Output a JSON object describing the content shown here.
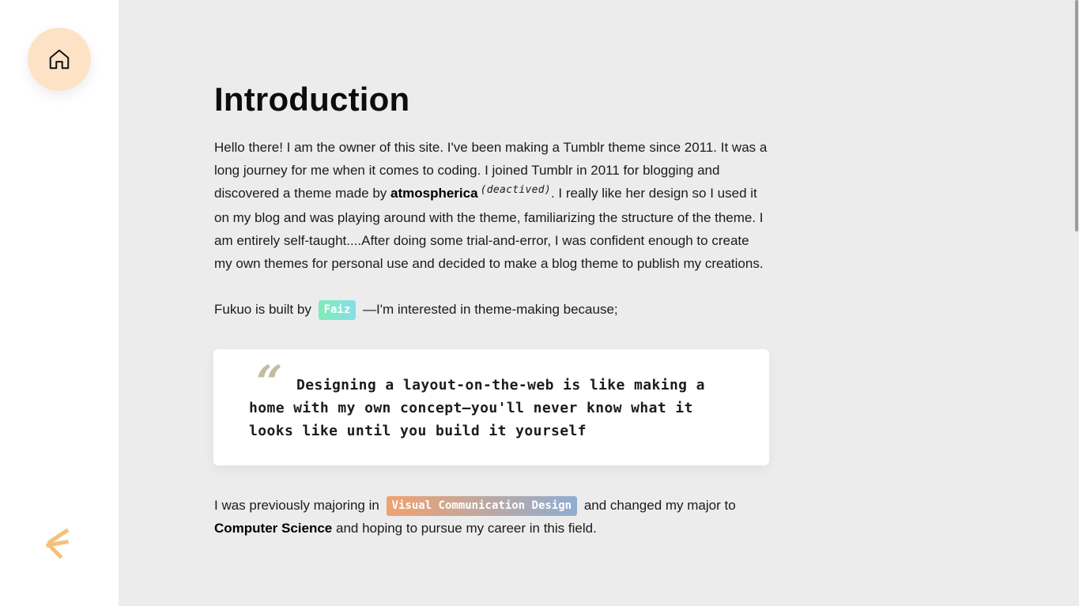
{
  "sidebar": {
    "home_icon": "home-icon",
    "logo_icon": "fukuo-logo-mark",
    "colors": {
      "home_bg": "#fde2c6",
      "logo": "#f5c07a"
    }
  },
  "article": {
    "title": "Introduction",
    "intro": {
      "part1": "Hello there! I am the owner of this site. I've been making a Tumblr theme since 2011. It was a long journey for me when it comes to coding. I joined Tumblr in 2011 for blogging and discovered a theme made by ",
      "author": "atmospherica",
      "deactived": "(deactived)",
      "part2": ". I really like her design so I used it on my blog and was playing around with the theme, familiarizing the structure of the theme. I am entirely self-taught....After doing some trial-and-error, I was confident enough to create my own themes for personal use and decided to make a blog theme to publish my creations."
    },
    "built_by": {
      "prefix": "Fukuo is built by ",
      "name_tag": "Faiz",
      "suffix": " —I'm interested in theme-making because;"
    },
    "quote": {
      "mark": "“",
      "text": "Designing a layout-on-the-web is like making a home with my own concept—you'll never know what it looks like until you build it yourself"
    },
    "major": {
      "prefix": "I was previously majoring in ",
      "old_major_tag": "Visual Communication Design",
      "middle": " and changed my major to ",
      "new_major": "Computer Science",
      "suffix": " and hoping to pursue my career in this field."
    }
  }
}
